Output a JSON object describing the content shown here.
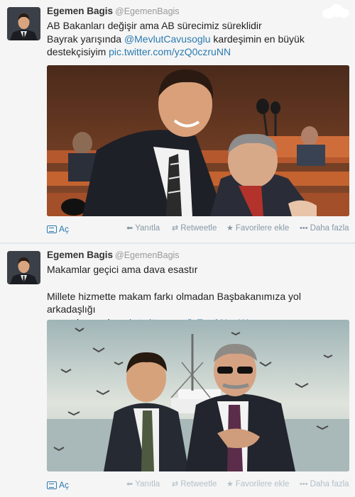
{
  "tweets": [
    {
      "fullname": "Egemen Bagis",
      "username": "@EgemenBagis",
      "text_line1": "AB Bakanları değişir ama AB sürecimiz süreklidir",
      "text_line2_before": "Bayrak yarışında ",
      "mention": "@MevlutCavusoglu",
      "text_line2_after": " kardeşimin en büyük",
      "text_line3": "destekçisiyim ",
      "pic_link": "pic.twitter.com/yzQ0czruNN",
      "actions": {
        "open": "Aç",
        "reply": "Yanıtla",
        "retweet": "Retweetle",
        "favorite": "Favorilere ekle",
        "more": "Daha fazla"
      }
    },
    {
      "fullname": "Egemen Bagis",
      "username": "@EgemenBagis",
      "text_line1": "Makamlar geçici ama dava esastır",
      "text_line2": "Millete hizmette makam farkı olmadan Başbakanımıza yol arkadaşlığı",
      "text_line3": "yapmak onurdur. ",
      "pic_link": "pic.twitter.com/lcExwkNguW",
      "actions": {
        "open": "Aç",
        "reply": "Yanıtla",
        "retweet": "Retweetle",
        "favorite": "Favorilere ekle",
        "more": "Daha fazla"
      }
    }
  ],
  "icons": {
    "media": "media-icon",
    "reply": "reply-arrow-icon",
    "retweet": "retweet-icon",
    "favorite": "star-icon",
    "more": "more-dots-icon"
  },
  "colors": {
    "link": "#2a7ab0",
    "background": "#f5f5f5",
    "muted": "#8899a6"
  }
}
